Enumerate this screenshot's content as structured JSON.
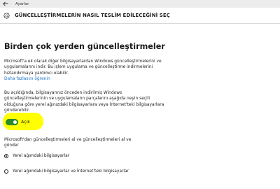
{
  "window": {
    "title": "Ayarlar",
    "back_icon": "back-arrow-icon"
  },
  "header": {
    "gear_icon": "gear-icon",
    "title": "GÜNCELLEŞTİRMELERİN NASIL TESLİM EDİLECEĞİNİ SEÇ"
  },
  "main": {
    "section_title": "Birden çok yerden güncelleştirmeler",
    "description_1": "Microsoft'a ek olarak diğer bilgisayarlardan Windows güncelleştirmelerini ve uygulamalarını indir. Bu işlem uygulama ve güncelleştirme indirmelerini hızlandırmaya yardımcı olabilir.",
    "learn_more_link": "Daha fazlasını öğrenin",
    "description_2": "Bu açıldığında, bilgisayarınız önceden indirilmiş Windows güncelleştirmelerinin ve uygulamaların parçalarını aşağıda neyin seçili olduğuna göre yerel ağınızdaki bilgisayarlara veya İnternet'teki bilgisayarlara gönderebilir.",
    "toggle": {
      "state": "on",
      "label": "Açık",
      "color": "#2a8a2a",
      "highlight_color": "#ffff00"
    },
    "radio_group_label": "Microsoft'dan güncelleştirmeleri al ve güncelleştirmeleri al ve gönder",
    "radio_options": [
      {
        "label": "Yerel ağımdaki bilgisayarlar",
        "selected": true
      },
      {
        "label": "Yerel ağımdaki bilgisayarlar ve İnternet'teki bilgisayarlar",
        "selected": false
      }
    ]
  }
}
